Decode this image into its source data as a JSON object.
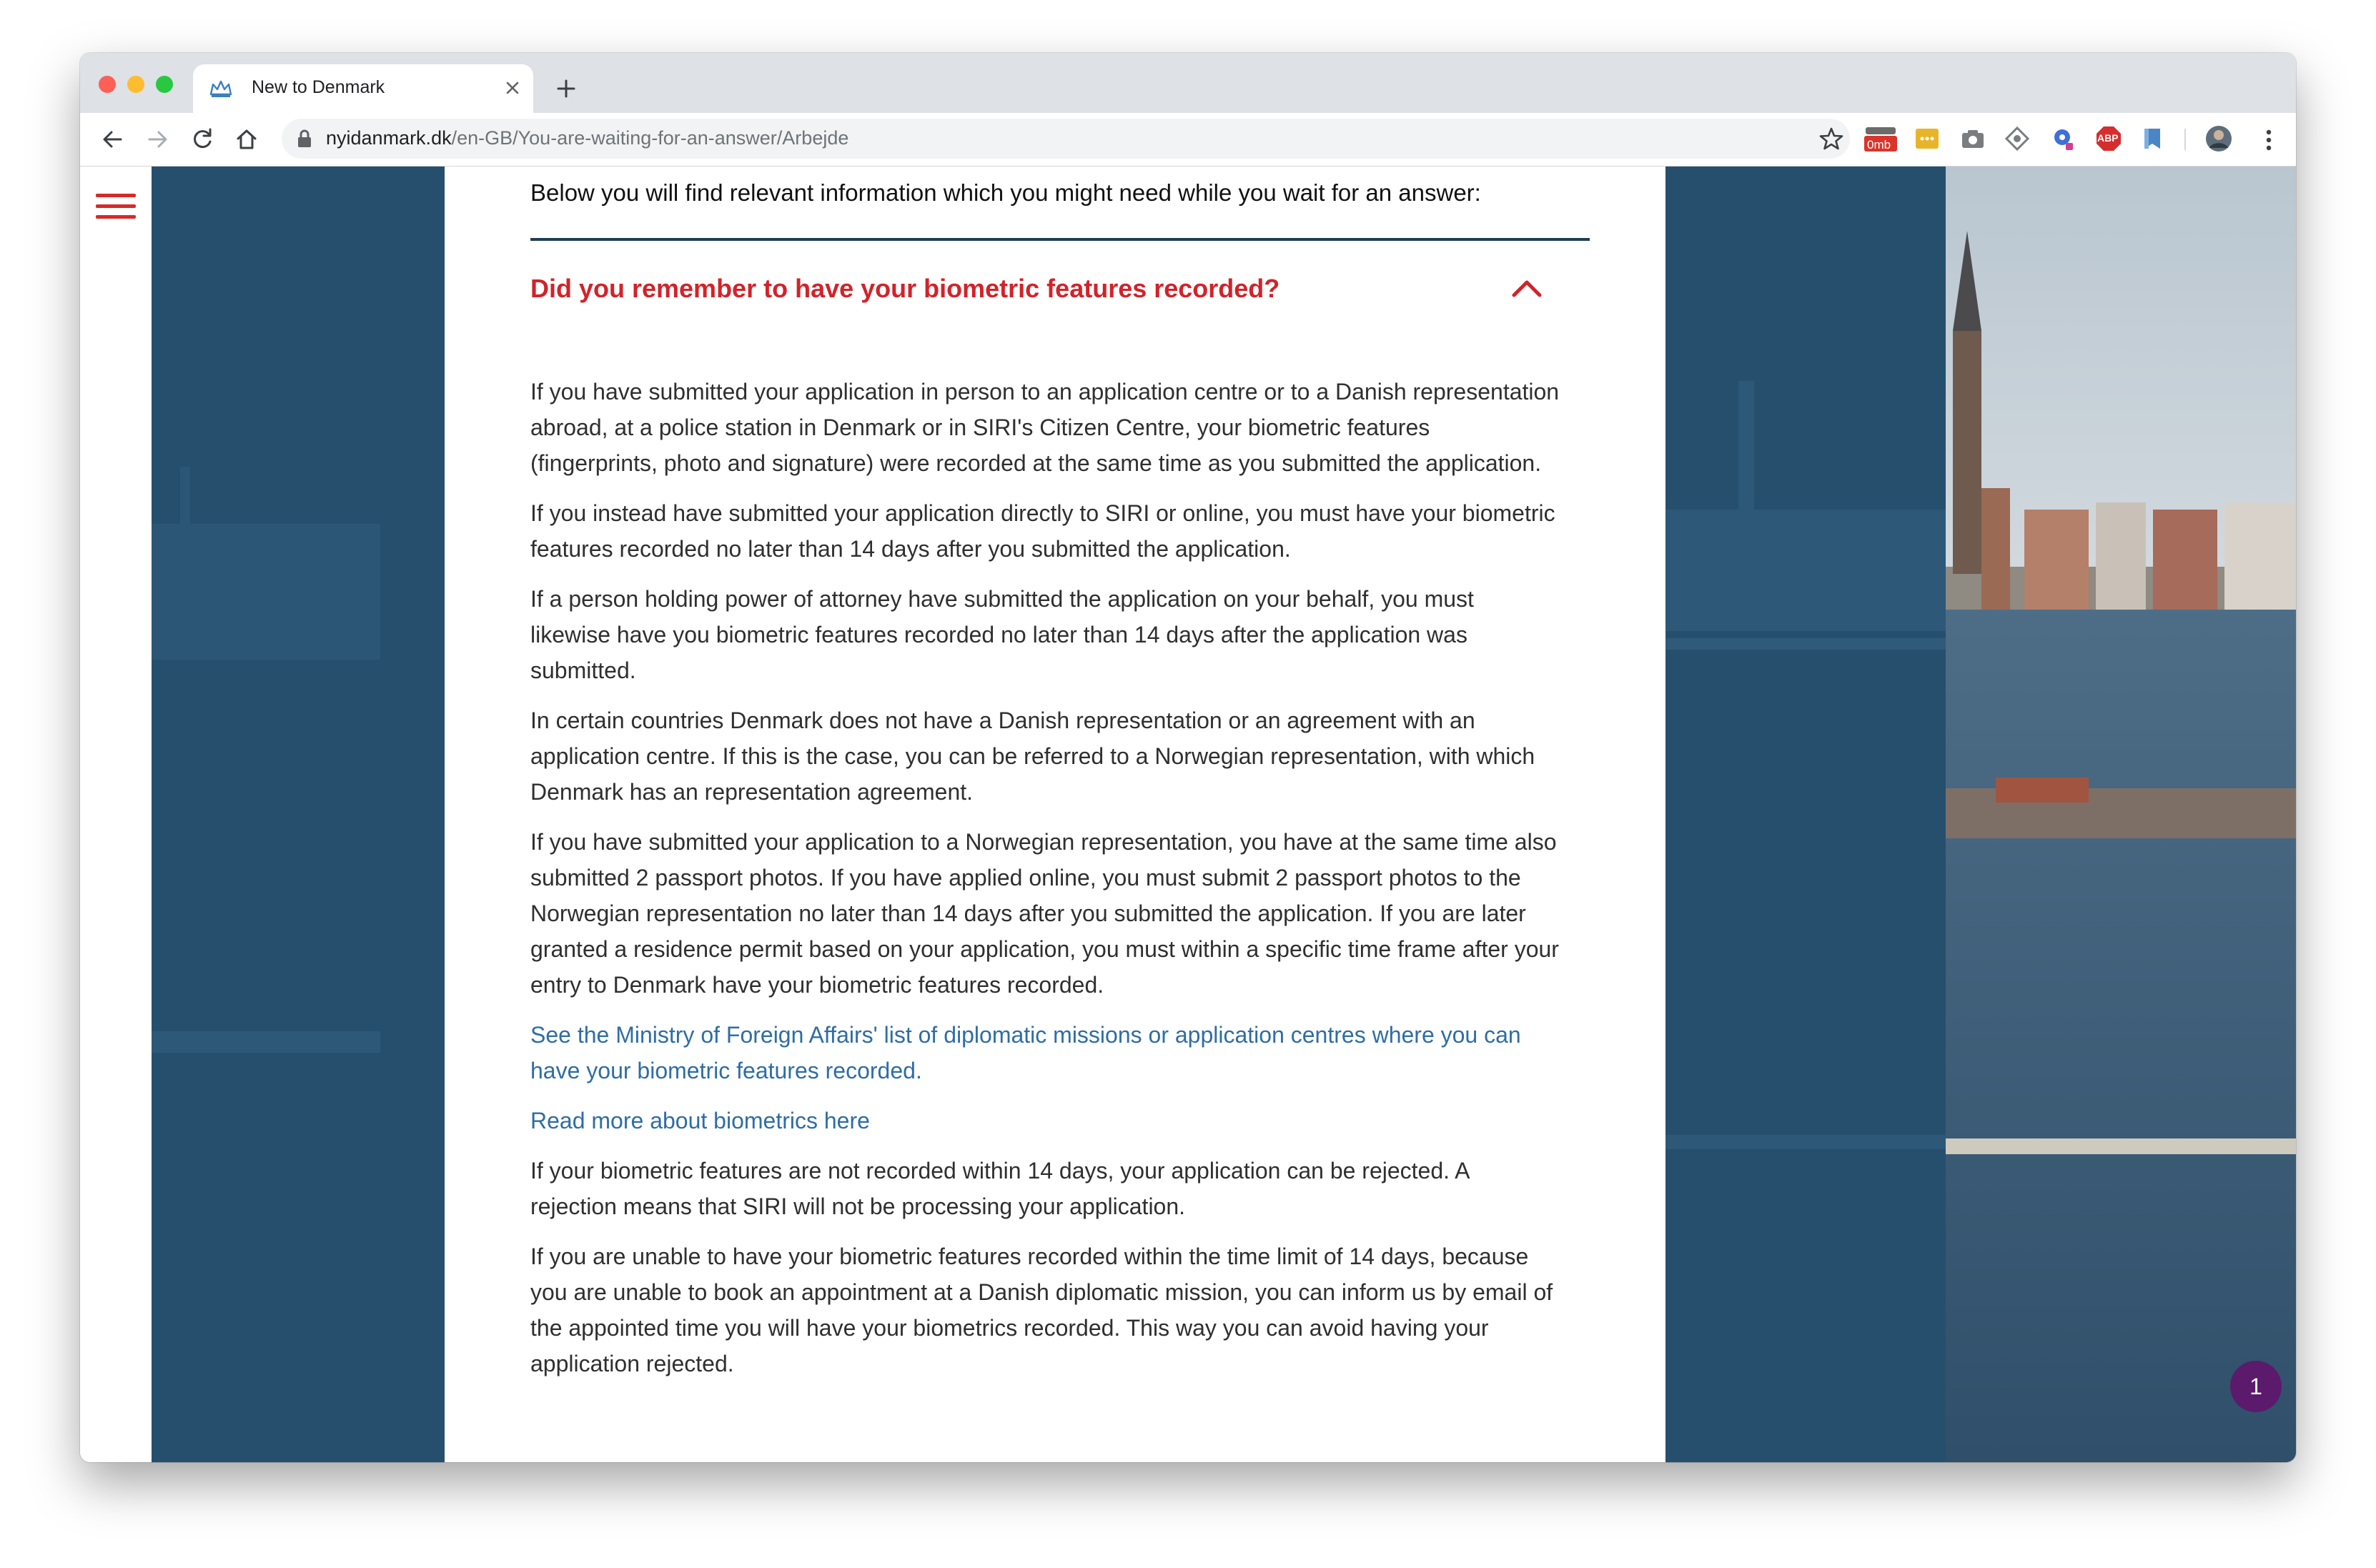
{
  "browser": {
    "tab_title": "New to Denmark",
    "url_host": "nyidanmark.dk",
    "url_path": "/en-GB/You-are-waiting-for-an-answer/Arbejde",
    "extension_badge": "0mb",
    "extension_abp": "ABP"
  },
  "page": {
    "intro": "Below you will find relevant information which you might need while you wait for an answer:",
    "accordion_title": "Did you remember to have your biometric features recorded?",
    "paragraphs": [
      "If you have submitted your application in person to an application centre or to a Danish representation abroad, at a police station in Denmark or in SIRI's Citizen Centre, your biometric features (fingerprints, photo and signature) were recorded at the same time as you submitted the application.",
      "If you instead have submitted your application directly to SIRI or online, you must have your biometric features recorded no later than 14 days after you submitted the application.",
      "If a person holding power of attorney have submitted the application on your behalf, you must likewise have you biometric features recorded no later than 14 days after the application was submitted.",
      "In certain countries Denmark does not have a Danish representation or an agreement with an application centre. If this is the case, you can be referred to a Norwegian representation, with which Denmark has an representation agreement.",
      "If you have submitted your application to a Norwegian representation, you have at the same time also submitted 2 passport photos. If you have applied online, you must submit 2 passport photos to the Norwegian representation no later than 14 days after you submitted the application. If you are later granted a residence permit based on your application, you must within a specific time frame after your entry to Denmark have your biometric features recorded."
    ],
    "link_missions": "See the Ministry of Foreign Affairs' list of diplomatic missions or application centres where you can have your biometric features recorded.",
    "link_biometrics": "Read more about biometrics here",
    "paragraph_rejection": "If your biometric features are not recorded within 14 days, your application can be rejected. A rejection means that SIRI will not be processing your application.",
    "paragraph_unable": "If you are unable to have your biometric features recorded within the time limit of 14 days, because you are unable to book an appointment at a Danish diplomatic mission, you can inform us by email of the appointed time you will have your biometrics recorded. This way you can avoid having your application rejected.",
    "notification_count": "1"
  },
  "colors": {
    "accent_red": "#d2232a",
    "link_blue": "#2e6da4",
    "background_blue": "#275a7a",
    "badge_purple": "#5b1a6b"
  }
}
